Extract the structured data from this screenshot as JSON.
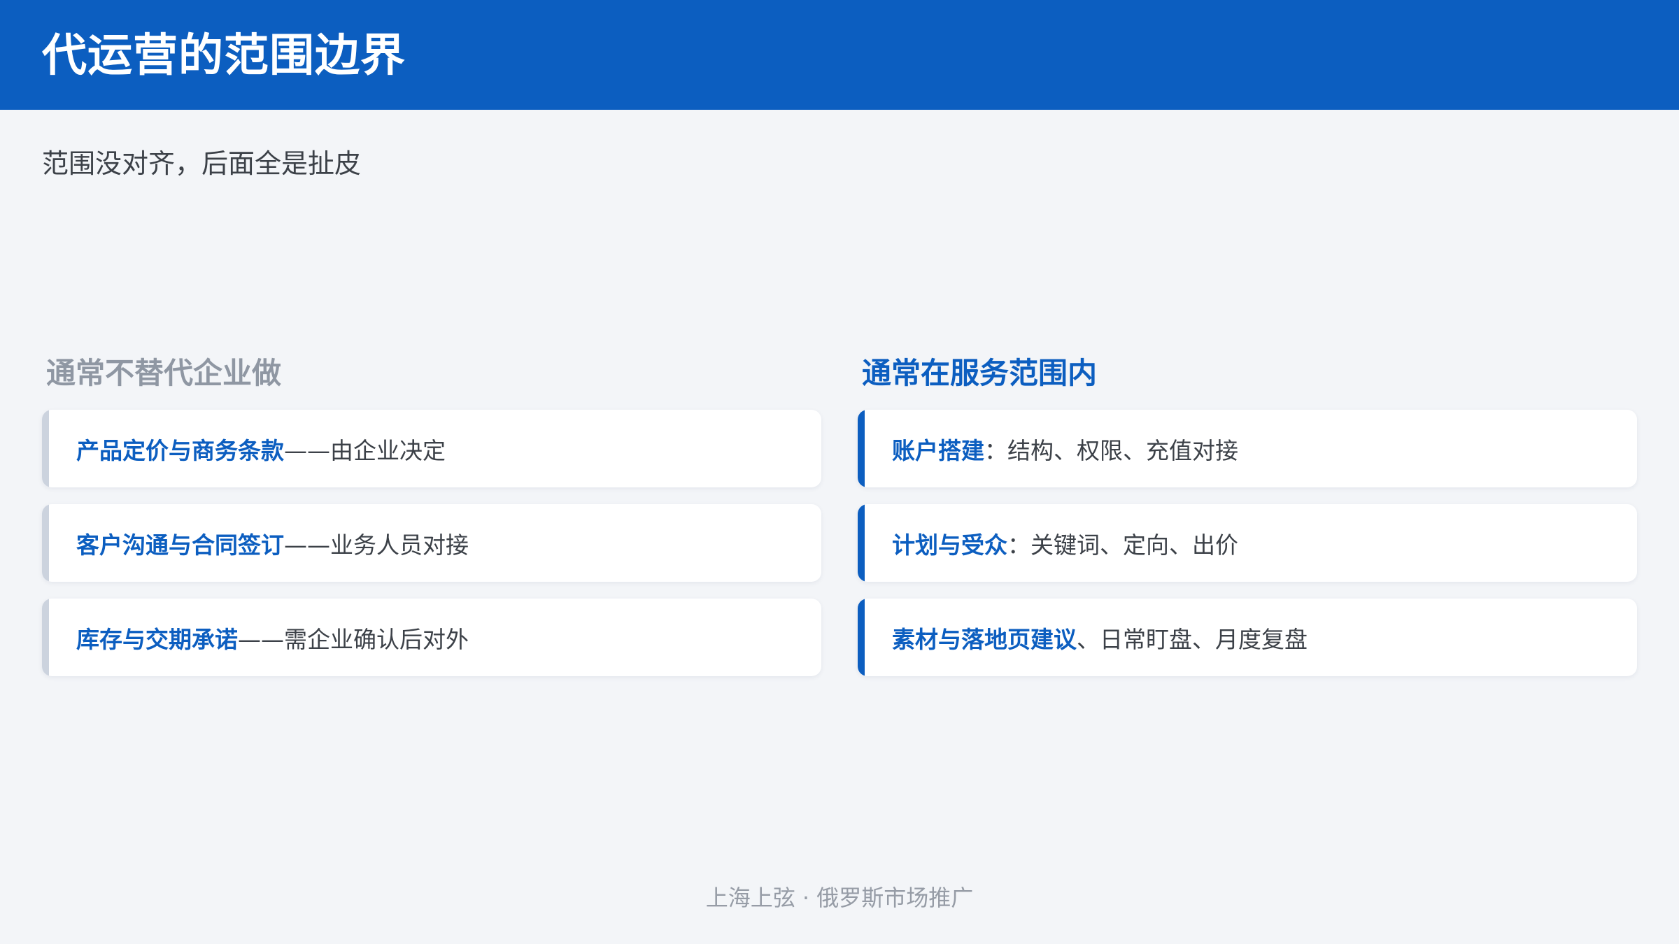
{
  "header": {
    "title": "代运营的范围边界"
  },
  "subtitle": "范围没对齐，后面全是扯皮",
  "left_column": {
    "heading": "通常不替代企业做",
    "items": [
      {
        "bold": "产品定价与商务条款",
        "rest": "——由企业决定"
      },
      {
        "bold": "客户沟通与合同签订",
        "rest": "——业务人员对接"
      },
      {
        "bold": "库存与交期承诺",
        "rest": "——需企业确认后对外"
      }
    ]
  },
  "right_column": {
    "heading": "通常在服务范围内",
    "items": [
      {
        "bold": "账户搭建",
        "rest": "：结构、权限、充值对接"
      },
      {
        "bold": "计划与受众",
        "rest": "：关键词、定向、出价"
      },
      {
        "bold": "素材与落地页建议",
        "rest": "、日常盯盘、月度复盘"
      }
    ]
  },
  "footer": "上海上弦 · 俄罗斯市场推广",
  "colors": {
    "brand": "#0c5ec0",
    "background": "#f3f5f8",
    "muted_heading": "#8f97a3",
    "left_accent": "#ccd3de"
  }
}
